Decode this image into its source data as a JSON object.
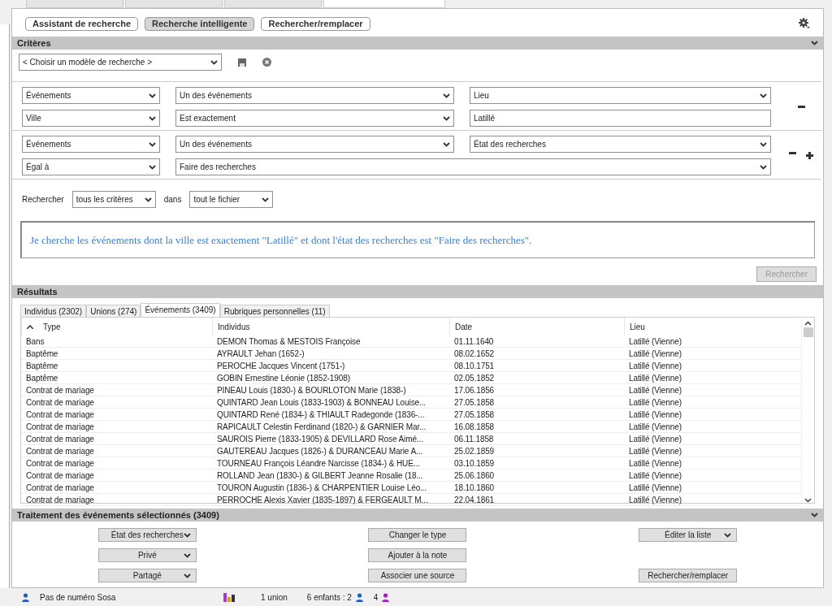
{
  "top_tabs": [
    {
      "selected": false
    },
    {
      "selected": false
    },
    {
      "selected": false
    },
    {
      "selected": true
    }
  ],
  "modes": [
    {
      "label": "Assistant de recherche",
      "selected": false
    },
    {
      "label": "Recherche intelligente",
      "selected": true
    },
    {
      "label": "Rechercher/remplacer",
      "selected": false
    }
  ],
  "criteria": {
    "title": "Critères",
    "template": "< Choisir un modèle de recherche >",
    "groups": [
      {
        "removable": true,
        "addable": false,
        "rows": [
          [
            {
              "kind": "select",
              "value": "Événements"
            },
            {
              "kind": "select",
              "value": "Un des événements"
            },
            {
              "kind": "select",
              "value": "Lieu"
            }
          ],
          [
            {
              "kind": "select",
              "value": "Ville"
            },
            {
              "kind": "select",
              "value": "Est exactement"
            },
            {
              "kind": "input",
              "value": "Latillé"
            }
          ]
        ]
      },
      {
        "removable": true,
        "addable": true,
        "rows": [
          [
            {
              "kind": "select",
              "value": "Événements"
            },
            {
              "kind": "select",
              "value": "Un des événements"
            },
            {
              "kind": "select",
              "value": "État des recherches"
            }
          ],
          [
            {
              "kind": "select",
              "value": "Égal à"
            },
            {
              "kind": "select",
              "value": "Faire des recherches"
            }
          ]
        ]
      }
    ],
    "search_label": "Rechercher",
    "match": "tous les critères",
    "in_label": "dans",
    "scope": "tout le fichier",
    "description": "Je cherche les événements dont la ville est exactement \"Latillé\" et dont l'état des recherches est \"Faire des recherches\".",
    "search_button": {
      "label": "Rechercher",
      "disabled": true
    }
  },
  "results": {
    "title": "Résultats",
    "tabs": [
      {
        "label": "Individus (2302)",
        "selected": false
      },
      {
        "label": "Unions (274)",
        "selected": false
      },
      {
        "label": "Événements (3409)",
        "selected": true
      },
      {
        "label": "Rubriques personnelles (11)",
        "selected": false
      }
    ],
    "columns": [
      {
        "label": "Type",
        "sorted": true
      },
      {
        "label": "Individus",
        "sorted": false
      },
      {
        "label": "Date",
        "sorted": false
      },
      {
        "label": "Lieu",
        "sorted": false
      }
    ],
    "rows": [
      [
        "Bans",
        "DEMON Thomas & MESTOIS Françoise",
        "01.11.1640",
        "Latillé (Vienne)"
      ],
      [
        "Baptême",
        "AYRAULT Jehan (1652-)",
        "08.02.1652",
        "Latillé (Vienne)"
      ],
      [
        "Baptême",
        "PEROCHE Jacques Vincent (1751-)",
        "08.10.1751",
        "Latillé (Vienne)"
      ],
      [
        "Baptême",
        "GOBIN Ernestine Léonie (1852-1908)",
        "02.05.1852",
        "Latillé (Vienne)"
      ],
      [
        "Contrat de mariage",
        "PINEAU Louis (1830-) & BOURLOTON Marie (1838-)",
        "17.06.1856",
        "Latillé (Vienne)"
      ],
      [
        "Contrat de mariage",
        "QUINTARD Jean Louis (1833-1903) & BONNEAU Louise...",
        "27.05.1858",
        "Latillé (Vienne)"
      ],
      [
        "Contrat de mariage",
        "QUINTARD René (1834-) & THIAULT Radegonde (1836-...",
        "27.05.1858",
        "Latillé (Vienne)"
      ],
      [
        "Contrat de mariage",
        "RAPICAULT Celestin Ferdinand (1820-) & GARNIER Mar...",
        "16.08.1858",
        "Latillé (Vienne)"
      ],
      [
        "Contrat de mariage",
        "SAUROIS Pierre (1833-1905) & DEVILLARD Rose Aimé...",
        "06.11.1858",
        "Latillé (Vienne)"
      ],
      [
        "Contrat de mariage",
        "GAUTEREAU Jacques (1826-) & DURANCEAU Marie A...",
        "25.02.1859",
        "Latillé (Vienne)"
      ],
      [
        "Contrat de mariage",
        "TOURNEAU François Léandre Narcisse (1834-) & HUE...",
        "03.10.1859",
        "Latillé (Vienne)"
      ],
      [
        "Contrat de mariage",
        "ROLLAND Jean (1830-) & GILBERT Jeanne Rosalie (18...",
        "25.06.1860",
        "Latillé (Vienne)"
      ],
      [
        "Contrat de mariage",
        "TOURON Augustin (1836-) & CHARPENTIER Louise Léo...",
        "18.10.1860",
        "Latillé (Vienne)"
      ],
      [
        "Contrat de mariage",
        "PERROCHE Alexis Xavier (1835-1897) & FERGEAULT M...",
        "22.04.1861",
        "Latillé (Vienne)"
      ]
    ]
  },
  "treatment": {
    "title": "Traitement des événements sélectionnés (3409)",
    "rows": [
      [
        {
          "kind": "dropdown",
          "label": "État des recherches"
        },
        {
          "kind": "button",
          "label": "Changer le type"
        },
        {
          "kind": "dropdown",
          "label": "Éditer la liste"
        }
      ],
      [
        {
          "kind": "dropdown",
          "label": "Privé"
        },
        {
          "kind": "button",
          "label": "Ajouter à la note"
        }
      ],
      [
        {
          "kind": "dropdown",
          "label": "Partagé"
        },
        {
          "kind": "button",
          "label": "Associer une source"
        },
        {
          "kind": "button",
          "label": "Rechercher/remplacer"
        }
      ]
    ]
  },
  "status_bar": {
    "sosa": "Pas de numéro Sosa",
    "unions": "1 union",
    "children": "6 enfants : 2",
    "daughters": "4"
  }
}
